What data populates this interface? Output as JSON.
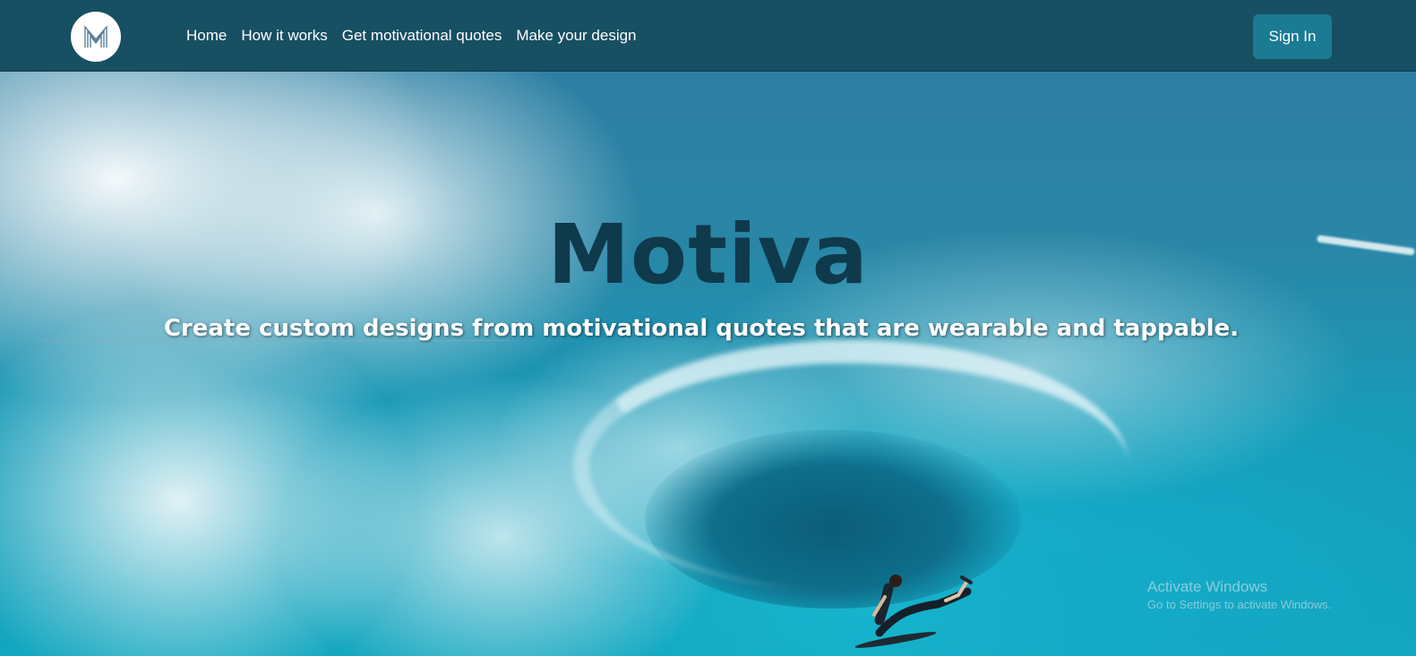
{
  "nav": {
    "logo_letter": "M",
    "links": [
      "Home",
      "How it works",
      "Get motivational quotes",
      "Make your design"
    ],
    "sign_in_label": "Sign In"
  },
  "hero": {
    "title": "Motiva",
    "subtitle": "Create custom designs from motivational quotes that are wearable and tappable."
  },
  "watermark": {
    "title": "Activate Windows",
    "subtitle": "Go to Settings to activate Windows."
  },
  "colors": {
    "navbar_bg": "#174f63",
    "signin_bg": "#1a7b93",
    "title_color": "#0f3a4c"
  }
}
